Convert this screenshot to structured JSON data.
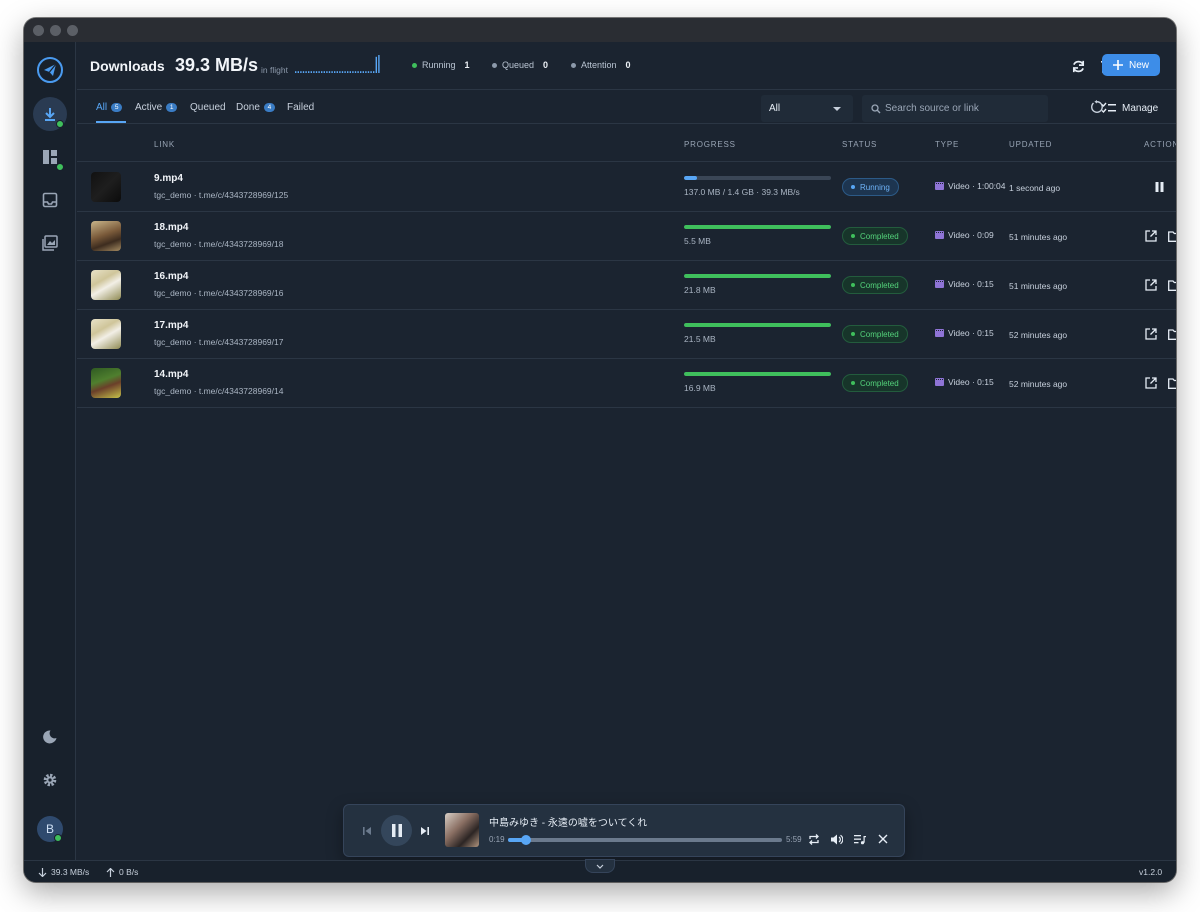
{
  "app": {
    "header": {
      "title": "Downloads",
      "speed": "39.3 MB/s",
      "speed_caption": "in flight",
      "stats": [
        {
          "label": "Running",
          "value": "1",
          "color": "#3fbf5c"
        },
        {
          "label": "Queued",
          "value": "0",
          "color": "#8c99aa"
        },
        {
          "label": "Attention",
          "value": "0",
          "color": "#8c99aa"
        }
      ],
      "new_label": "New",
      "sparkline": [
        1,
        1,
        1,
        1,
        1,
        1,
        1,
        1,
        1,
        1,
        1,
        1,
        1,
        1,
        1,
        1,
        1,
        1,
        1,
        1,
        1,
        1,
        1,
        1,
        1,
        1,
        1,
        1,
        1,
        1,
        1,
        9,
        10
      ]
    },
    "tabs": [
      {
        "label": "All",
        "badge": "5",
        "active": true
      },
      {
        "label": "Active",
        "badge": "1",
        "active": false
      },
      {
        "label": "Queued",
        "badge": "",
        "active": false
      },
      {
        "label": "Done",
        "badge": "4",
        "active": false
      },
      {
        "label": "Failed",
        "badge": "",
        "active": false
      }
    ],
    "filter": {
      "value": "All"
    },
    "search": {
      "placeholder": "Search source or link"
    },
    "manage_label": "Manage",
    "columns": {
      "link": "LINK",
      "progress": "PROGRESS",
      "status": "STATUS",
      "type": "TYPE",
      "updated": "UPDATED",
      "actions": "ACTIONS"
    },
    "rows": [
      {
        "name": "9.mp4",
        "source": "tgc_demo · t.me/c/4343728969/125",
        "progress_text": "137.0 MB / 1.4 GB · 39.3 MB/s",
        "progress": 0.09,
        "status": "Running",
        "type": "Video · 1:00:04",
        "updated": "1 second ago",
        "thumb": "dark"
      },
      {
        "name": "18.mp4",
        "source": "tgc_demo · t.me/c/4343728969/18",
        "progress_text": "5.5 MB",
        "progress": 1.0,
        "status": "Completed",
        "type": "Video · 0:09",
        "updated": "51 minutes ago",
        "thumb": "brown"
      },
      {
        "name": "16.mp4",
        "source": "tgc_demo · t.me/c/4343728969/16",
        "progress_text": "21.8 MB",
        "progress": 1.0,
        "status": "Completed",
        "type": "Video · 0:15",
        "updated": "51 minutes ago",
        "thumb": "white"
      },
      {
        "name": "17.mp4",
        "source": "tgc_demo · t.me/c/4343728969/17",
        "progress_text": "21.5 MB",
        "progress": 1.0,
        "status": "Completed",
        "type": "Video · 0:15",
        "updated": "52 minutes ago",
        "thumb": "white"
      },
      {
        "name": "14.mp4",
        "source": "tgc_demo · t.me/c/4343728969/14",
        "progress_text": "16.9 MB",
        "progress": 1.0,
        "status": "Completed",
        "type": "Video · 0:15",
        "updated": "52 minutes ago",
        "thumb": "green"
      }
    ],
    "player": {
      "title": "中島みゆき - 永遠の嘘をついてくれ",
      "elapsed": "0:19",
      "duration": "5:59",
      "progress": 0.053
    },
    "sidebar": {
      "avatar_letter": "B"
    },
    "footer": {
      "down": "39.3 MB/s",
      "up": "0 B/s",
      "version": "v1.2.0"
    },
    "colors": {
      "accent": "#3d8de8",
      "running": "#58a6f5",
      "completed": "#3fbf5c"
    }
  }
}
